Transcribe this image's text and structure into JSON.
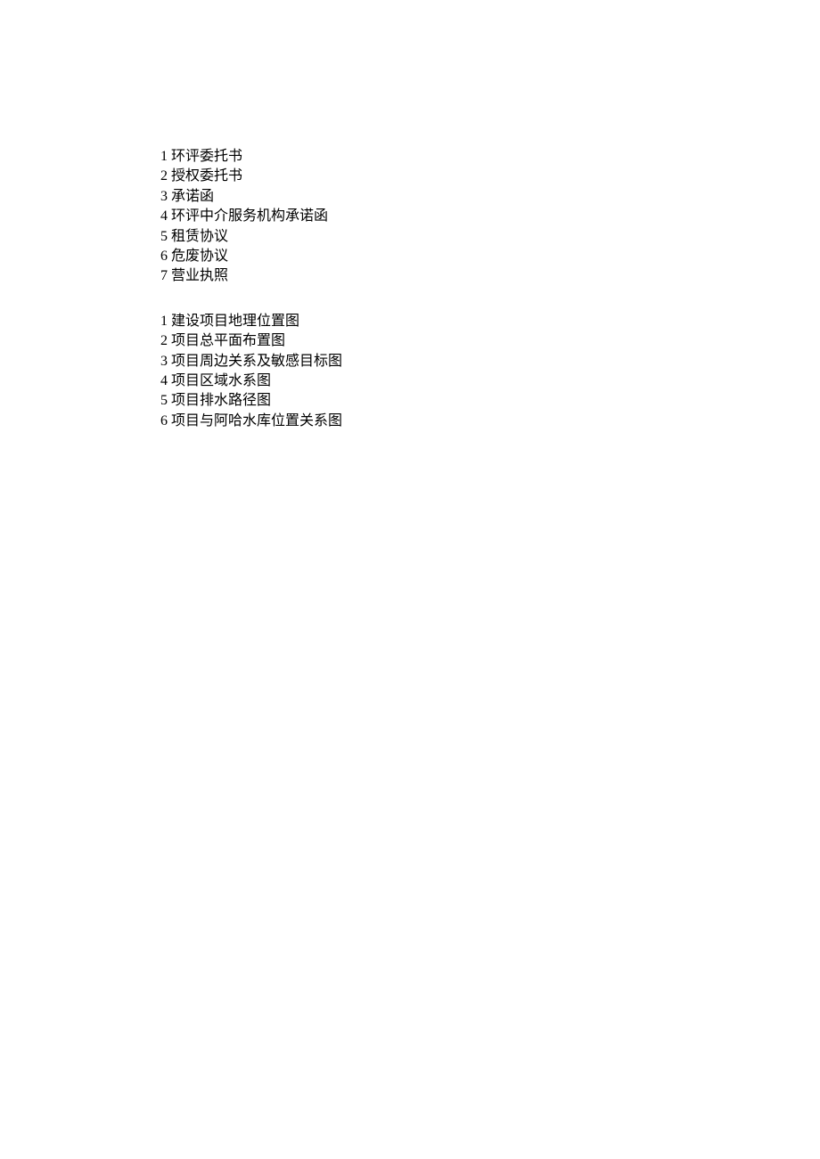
{
  "lists": [
    {
      "items": [
        {
          "number": "1",
          "label": "环评委托书"
        },
        {
          "number": "2",
          "label": "授权委托书"
        },
        {
          "number": "3",
          "label": "承诺函"
        },
        {
          "number": "4",
          "label": "环评中介服务机构承诺函"
        },
        {
          "number": "5",
          "label": "租赁协议"
        },
        {
          "number": "6",
          "label": "危废协议"
        },
        {
          "number": "7",
          "label": "营业执照"
        }
      ]
    },
    {
      "items": [
        {
          "number": "1",
          "label": "建设项目地理位置图"
        },
        {
          "number": "2",
          "label": "项目总平面布置图"
        },
        {
          "number": "3",
          "label": "项目周边关系及敏感目标图"
        },
        {
          "number": "4",
          "label": "项目区域水系图"
        },
        {
          "number": "5",
          "label": "项目排水路径图"
        },
        {
          "number": "6",
          "label": "项目与阿哈水库位置关系图"
        }
      ]
    }
  ]
}
